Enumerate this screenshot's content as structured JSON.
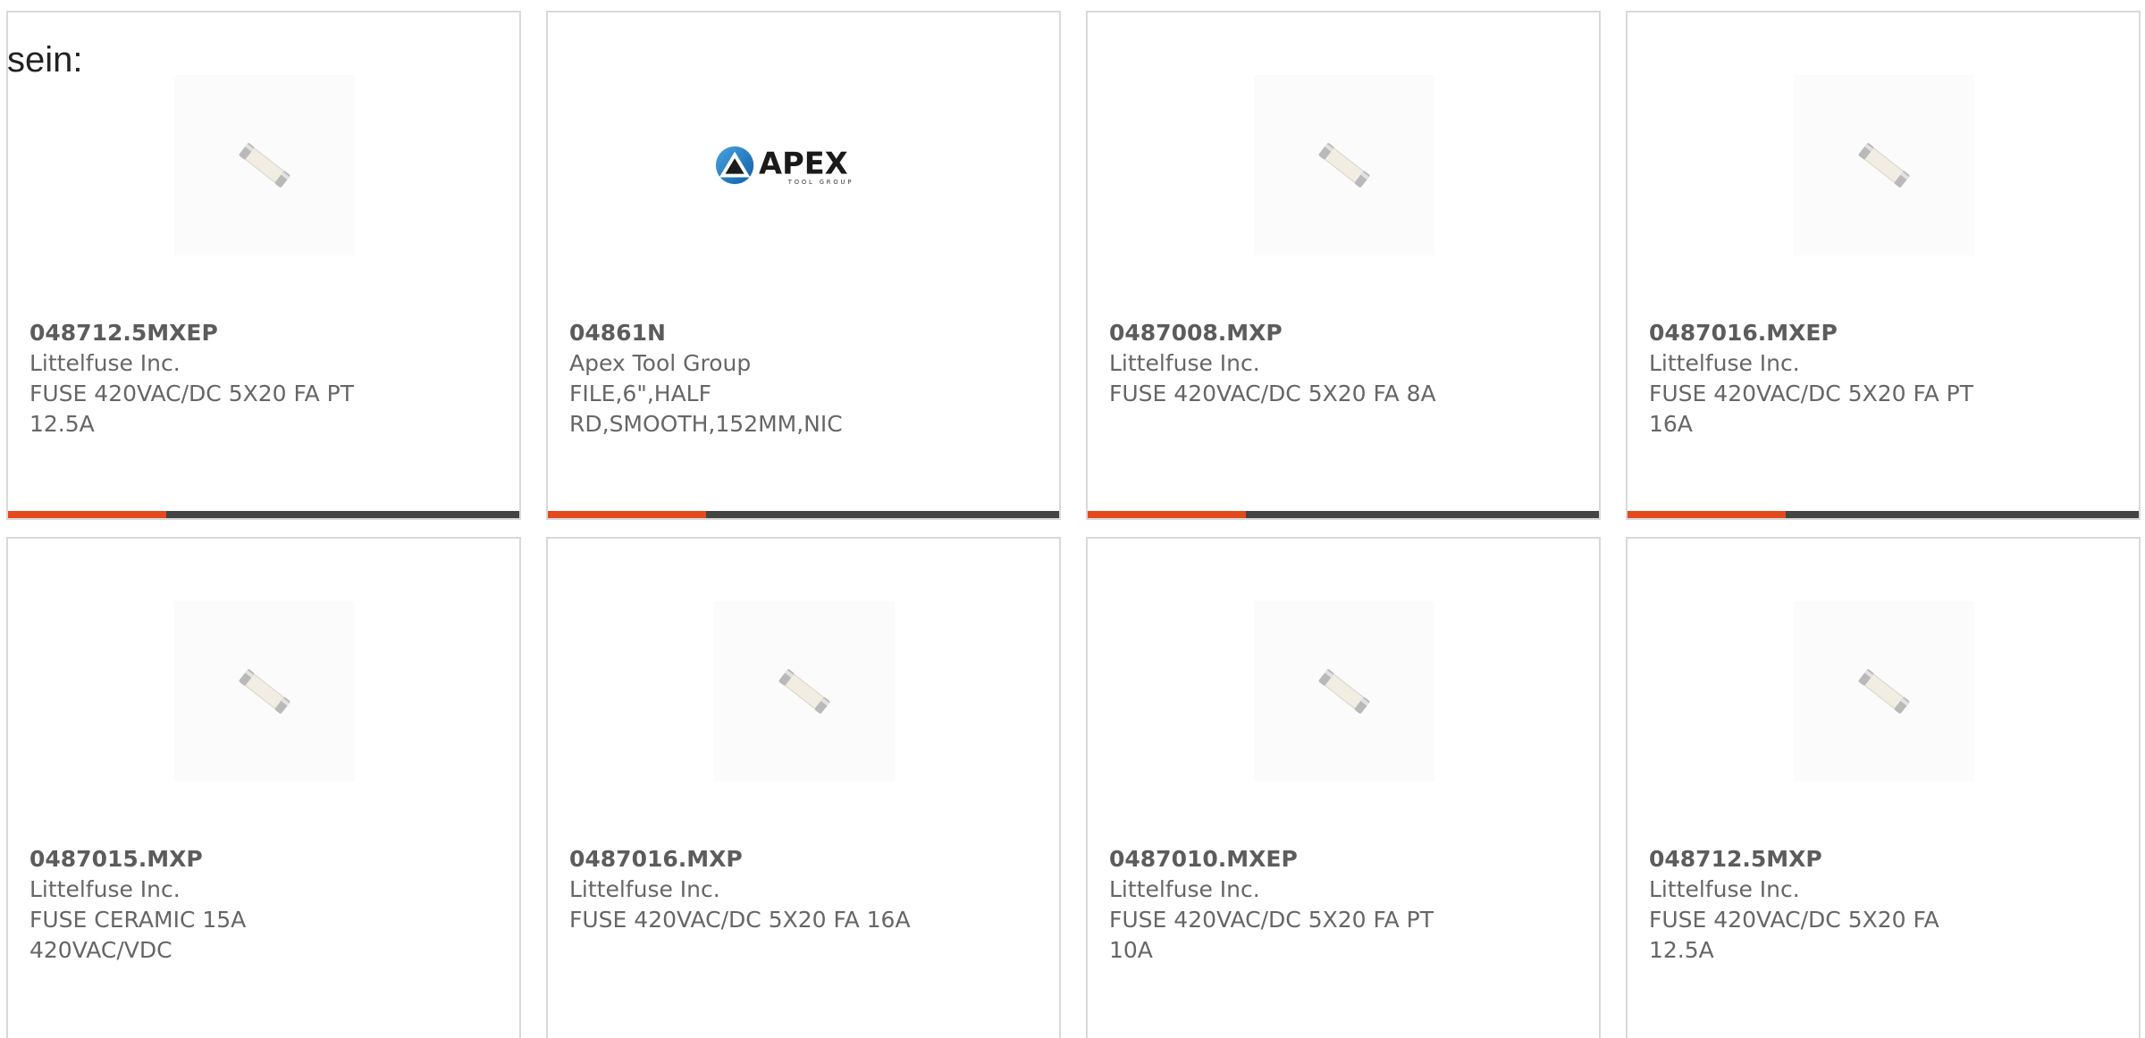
{
  "intro": "sein:",
  "colors": {
    "accent": "#e34a1c",
    "bar_dark": "#444444",
    "card_border": "#d9d9d9",
    "text_gray": "#666666"
  },
  "cards": [
    {
      "part_no": "048712.5MXEP",
      "manufacturer": "Littelfuse Inc.",
      "description_line1": "FUSE 420VAC/DC 5X20 FA PT",
      "description_line2": "12.5A",
      "image": "fuse-icon",
      "progress": 0.31
    },
    {
      "part_no": "04861N",
      "manufacturer": "Apex Tool Group",
      "description_line1": "FILE,6\",HALF",
      "description_line2": "RD,SMOOTH,152MM,NIC",
      "image": "apex-logo",
      "logo_word": "APEX",
      "logo_sub": "TOOL GROUP",
      "progress": 0.31
    },
    {
      "part_no": "0487008.MXP",
      "manufacturer": "Littelfuse Inc.",
      "description_line1": "FUSE 420VAC/DC 5X20 FA 8A",
      "description_line2": "",
      "image": "fuse-icon",
      "progress": 0.31
    },
    {
      "part_no": "0487016.MXEP",
      "manufacturer": "Littelfuse Inc.",
      "description_line1": "FUSE 420VAC/DC 5X20 FA PT 16A",
      "description_line2": "",
      "image": "fuse-icon",
      "progress": 0.31
    },
    {
      "part_no": "0487015.MXP",
      "manufacturer": "Littelfuse Inc.",
      "description_line1": "FUSE CERAMIC 15A 420VAC/VDC",
      "description_line2": "",
      "image": "fuse-icon"
    },
    {
      "part_no": "0487016.MXP",
      "manufacturer": "Littelfuse Inc.",
      "description_line1": "FUSE 420VAC/DC 5X20 FA 16A",
      "description_line2": "",
      "image": "fuse-icon"
    },
    {
      "part_no": "0487010.MXEP",
      "manufacturer": "Littelfuse Inc.",
      "description_line1": "FUSE 420VAC/DC 5X20 FA PT 10A",
      "description_line2": "",
      "image": "fuse-icon"
    },
    {
      "part_no": "048712.5MXP",
      "manufacturer": "Littelfuse Inc.",
      "description_line1": "FUSE 420VAC/DC 5X20 FA 12.5A",
      "description_line2": "",
      "image": "fuse-icon"
    }
  ]
}
